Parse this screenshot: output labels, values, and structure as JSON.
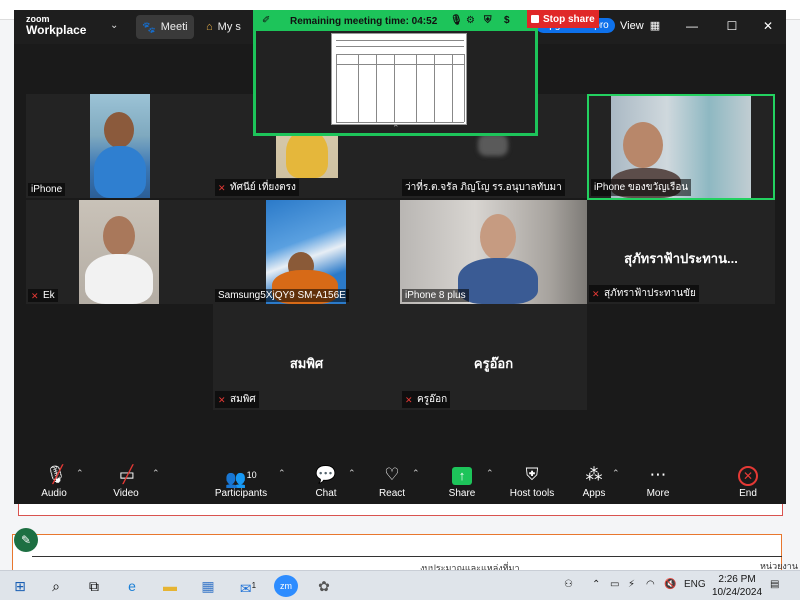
{
  "app": {
    "logo_line1": "zoom",
    "logo_line2": "Workplace"
  },
  "titlebar": {
    "tab_meeting": "Meeti",
    "tab_my": "My s",
    "time_fragment": "52",
    "upgrade_label": "Upgrade to pro",
    "view_label": "View"
  },
  "share": {
    "remaining_label": "Remaining meeting time: 04:52",
    "stop_share_label": "Stop share"
  },
  "tiles": [
    {
      "name": "iPhone",
      "muted": false
    },
    {
      "name": "ทัศนีย์ เที่ยงตรง",
      "muted": true
    },
    {
      "name": "ว่าที่ร.ต.จรัล ภิญโญ รร.อนุบาลทับมา",
      "muted": false
    },
    {
      "name": "iPhone ของขวัญเรือน",
      "muted": false,
      "active": true
    },
    {
      "name": "Ek",
      "muted": true
    },
    {
      "name": "Samsung5XjQY9 SM-A156E",
      "muted": false
    },
    {
      "name": "iPhone 8 plus",
      "muted": false
    },
    {
      "name": "สุภัทราฟ้าประทานขัย",
      "muted": true,
      "big_label": "สุภัทราฟ้าประทาน..."
    },
    {
      "name": "สมพิศ",
      "muted": true,
      "big_label": "สมพิศ"
    },
    {
      "name": "ครูอ๊อก",
      "muted": true,
      "big_label": "ครูอ๊อก"
    }
  ],
  "toolbar": {
    "audio": "Audio",
    "video": "Video",
    "participants": "Participants",
    "participants_count": "10",
    "chat": "Chat",
    "react": "React",
    "share": "Share",
    "host_tools": "Host tools",
    "apps": "Apps",
    "more": "More",
    "end": "End"
  },
  "background_doc": {
    "header_text": "งบประมาณและแหล่งที่มา",
    "header_text2": "หน่วยงาน"
  },
  "taskbar": {
    "lang": "ENG",
    "time": "2:26 PM",
    "date": "10/24/2024",
    "mail_badge": "1"
  },
  "colors": {
    "accent_green": "#1dc45a",
    "stop_red": "#e02828",
    "zoom_blue": "#0e71eb",
    "muted_red": "#e53935"
  }
}
